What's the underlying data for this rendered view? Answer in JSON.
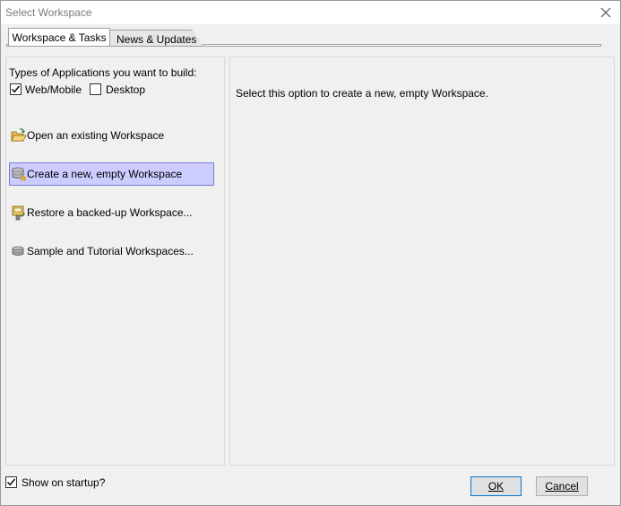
{
  "window": {
    "title": "Select Workspace"
  },
  "tabs": [
    {
      "label": "Workspace & Tasks",
      "active": true
    },
    {
      "label": "News & Updates",
      "active": false
    }
  ],
  "app_types": {
    "heading": "Types of Applications you want to build:",
    "options": [
      {
        "label": "Web/Mobile",
        "checked": true
      },
      {
        "label": "Desktop",
        "checked": false
      }
    ]
  },
  "tasks": [
    {
      "label": "Open an existing Workspace",
      "icon": "folder-open-icon",
      "selected": false
    },
    {
      "label": "Create a new, empty Workspace",
      "icon": "database-new-icon",
      "selected": true
    },
    {
      "label": "Restore a backed-up Workspace...",
      "icon": "restore-icon",
      "selected": false
    },
    {
      "label": "Sample and Tutorial Workspaces...",
      "icon": "database-icon",
      "selected": false
    }
  ],
  "description": "Select this option to create a new, empty Workspace.",
  "footer": {
    "show_on_startup_label": "Show on startup?",
    "show_on_startup_checked": true,
    "ok_label": "OK",
    "cancel_label": "Cancel"
  },
  "colors": {
    "selection_bg": "#ccccff",
    "selection_border": "#7b7bd6",
    "default_button_border": "#0078d7"
  }
}
